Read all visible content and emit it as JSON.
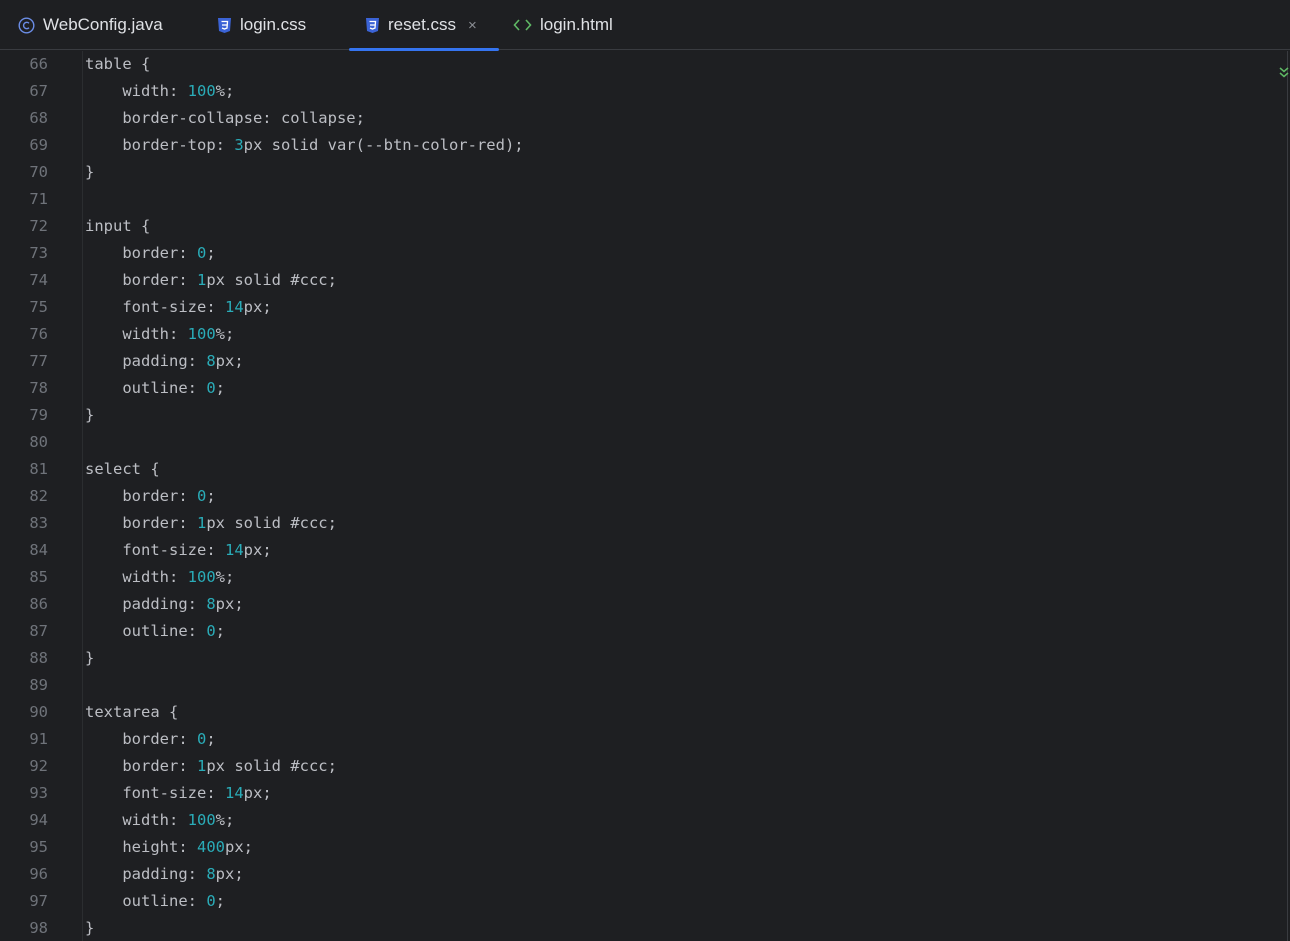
{
  "tabs": [
    {
      "label": "WebConfig.java",
      "icon": "java-class-icon",
      "active": false
    },
    {
      "label": "login.css",
      "icon": "css-file-icon",
      "active": false
    },
    {
      "label": "reset.css",
      "icon": "css-file-icon",
      "active": true,
      "close": "×"
    },
    {
      "label": "login.html",
      "icon": "html-file-icon",
      "active": false
    }
  ],
  "editor": {
    "lines": [
      {
        "n": "66",
        "tokens": [
          {
            "t": "table {",
            "c": "txt"
          }
        ]
      },
      {
        "n": "67",
        "tokens": [
          {
            "t": "    width: ",
            "c": "txt"
          },
          {
            "t": "100",
            "c": "num"
          },
          {
            "t": "%;",
            "c": "txt"
          }
        ]
      },
      {
        "n": "68",
        "tokens": [
          {
            "t": "    border-collapse: collapse;",
            "c": "txt"
          }
        ]
      },
      {
        "n": "69",
        "tokens": [
          {
            "t": "    border-top: ",
            "c": "txt"
          },
          {
            "t": "3",
            "c": "num"
          },
          {
            "t": "px solid var(--btn-color-red);",
            "c": "txt"
          }
        ]
      },
      {
        "n": "70",
        "tokens": [
          {
            "t": "}",
            "c": "txt"
          }
        ]
      },
      {
        "n": "71",
        "tokens": []
      },
      {
        "n": "72",
        "tokens": [
          {
            "t": "input {",
            "c": "txt"
          }
        ]
      },
      {
        "n": "73",
        "tokens": [
          {
            "t": "    border: ",
            "c": "txt"
          },
          {
            "t": "0",
            "c": "num"
          },
          {
            "t": ";",
            "c": "txt"
          }
        ]
      },
      {
        "n": "74",
        "tokens": [
          {
            "t": "    border: ",
            "c": "txt"
          },
          {
            "t": "1",
            "c": "num"
          },
          {
            "t": "px solid #ccc;",
            "c": "txt"
          }
        ]
      },
      {
        "n": "75",
        "tokens": [
          {
            "t": "    font-size: ",
            "c": "txt"
          },
          {
            "t": "14",
            "c": "num"
          },
          {
            "t": "px;",
            "c": "txt"
          }
        ]
      },
      {
        "n": "76",
        "tokens": [
          {
            "t": "    width: ",
            "c": "txt"
          },
          {
            "t": "100",
            "c": "num"
          },
          {
            "t": "%;",
            "c": "txt"
          }
        ]
      },
      {
        "n": "77",
        "tokens": [
          {
            "t": "    padding: ",
            "c": "txt"
          },
          {
            "t": "8",
            "c": "num"
          },
          {
            "t": "px;",
            "c": "txt"
          }
        ]
      },
      {
        "n": "78",
        "tokens": [
          {
            "t": "    outline: ",
            "c": "txt"
          },
          {
            "t": "0",
            "c": "num"
          },
          {
            "t": ";",
            "c": "txt"
          }
        ]
      },
      {
        "n": "79",
        "tokens": [
          {
            "t": "}",
            "c": "txt"
          }
        ]
      },
      {
        "n": "80",
        "tokens": []
      },
      {
        "n": "81",
        "tokens": [
          {
            "t": "select {",
            "c": "txt"
          }
        ]
      },
      {
        "n": "82",
        "tokens": [
          {
            "t": "    border: ",
            "c": "txt"
          },
          {
            "t": "0",
            "c": "num"
          },
          {
            "t": ";",
            "c": "txt"
          }
        ]
      },
      {
        "n": "83",
        "tokens": [
          {
            "t": "    border: ",
            "c": "txt"
          },
          {
            "t": "1",
            "c": "num"
          },
          {
            "t": "px solid #ccc;",
            "c": "txt"
          }
        ]
      },
      {
        "n": "84",
        "tokens": [
          {
            "t": "    font-size: ",
            "c": "txt"
          },
          {
            "t": "14",
            "c": "num"
          },
          {
            "t": "px;",
            "c": "txt"
          }
        ]
      },
      {
        "n": "85",
        "tokens": [
          {
            "t": "    width: ",
            "c": "txt"
          },
          {
            "t": "100",
            "c": "num"
          },
          {
            "t": "%;",
            "c": "txt"
          }
        ]
      },
      {
        "n": "86",
        "tokens": [
          {
            "t": "    padding: ",
            "c": "txt"
          },
          {
            "t": "8",
            "c": "num"
          },
          {
            "t": "px;",
            "c": "txt"
          }
        ]
      },
      {
        "n": "87",
        "tokens": [
          {
            "t": "    outline: ",
            "c": "txt"
          },
          {
            "t": "0",
            "c": "num"
          },
          {
            "t": ";",
            "c": "txt"
          }
        ]
      },
      {
        "n": "88",
        "tokens": [
          {
            "t": "}",
            "c": "txt"
          }
        ]
      },
      {
        "n": "89",
        "tokens": []
      },
      {
        "n": "90",
        "tokens": [
          {
            "t": "textarea {",
            "c": "txt"
          }
        ]
      },
      {
        "n": "91",
        "tokens": [
          {
            "t": "    border: ",
            "c": "txt"
          },
          {
            "t": "0",
            "c": "num"
          },
          {
            "t": ";",
            "c": "txt"
          }
        ]
      },
      {
        "n": "92",
        "tokens": [
          {
            "t": "    border: ",
            "c": "txt"
          },
          {
            "t": "1",
            "c": "num"
          },
          {
            "t": "px solid #ccc;",
            "c": "txt"
          }
        ]
      },
      {
        "n": "93",
        "tokens": [
          {
            "t": "    font-size: ",
            "c": "txt"
          },
          {
            "t": "14",
            "c": "num"
          },
          {
            "t": "px;",
            "c": "txt"
          }
        ]
      },
      {
        "n": "94",
        "tokens": [
          {
            "t": "    width: ",
            "c": "txt"
          },
          {
            "t": "100",
            "c": "num"
          },
          {
            "t": "%;",
            "c": "txt"
          }
        ]
      },
      {
        "n": "95",
        "tokens": [
          {
            "t": "    height: ",
            "c": "txt"
          },
          {
            "t": "400",
            "c": "num"
          },
          {
            "t": "px;",
            "c": "txt"
          }
        ]
      },
      {
        "n": "96",
        "tokens": [
          {
            "t": "    padding: ",
            "c": "txt"
          },
          {
            "t": "8",
            "c": "num"
          },
          {
            "t": "px;",
            "c": "txt"
          }
        ]
      },
      {
        "n": "97",
        "tokens": [
          {
            "t": "    outline: ",
            "c": "txt"
          },
          {
            "t": "0",
            "c": "num"
          },
          {
            "t": ";",
            "c": "txt"
          }
        ]
      },
      {
        "n": "98",
        "tokens": [
          {
            "t": "}",
            "c": "txt"
          }
        ]
      }
    ]
  },
  "colors": {
    "background": "#1e1f22",
    "text": "#bcbec4",
    "number": "#2aacb8",
    "line_number": "#6f737a",
    "active_tab_underline": "#3574f0",
    "css_icon": "#3b63d6",
    "java_icon": "#6b8de6",
    "html_icon": "#5fb865",
    "inspection_ok": "#5fb865"
  },
  "inspection": {
    "icon": "no-problems-check-icon"
  }
}
